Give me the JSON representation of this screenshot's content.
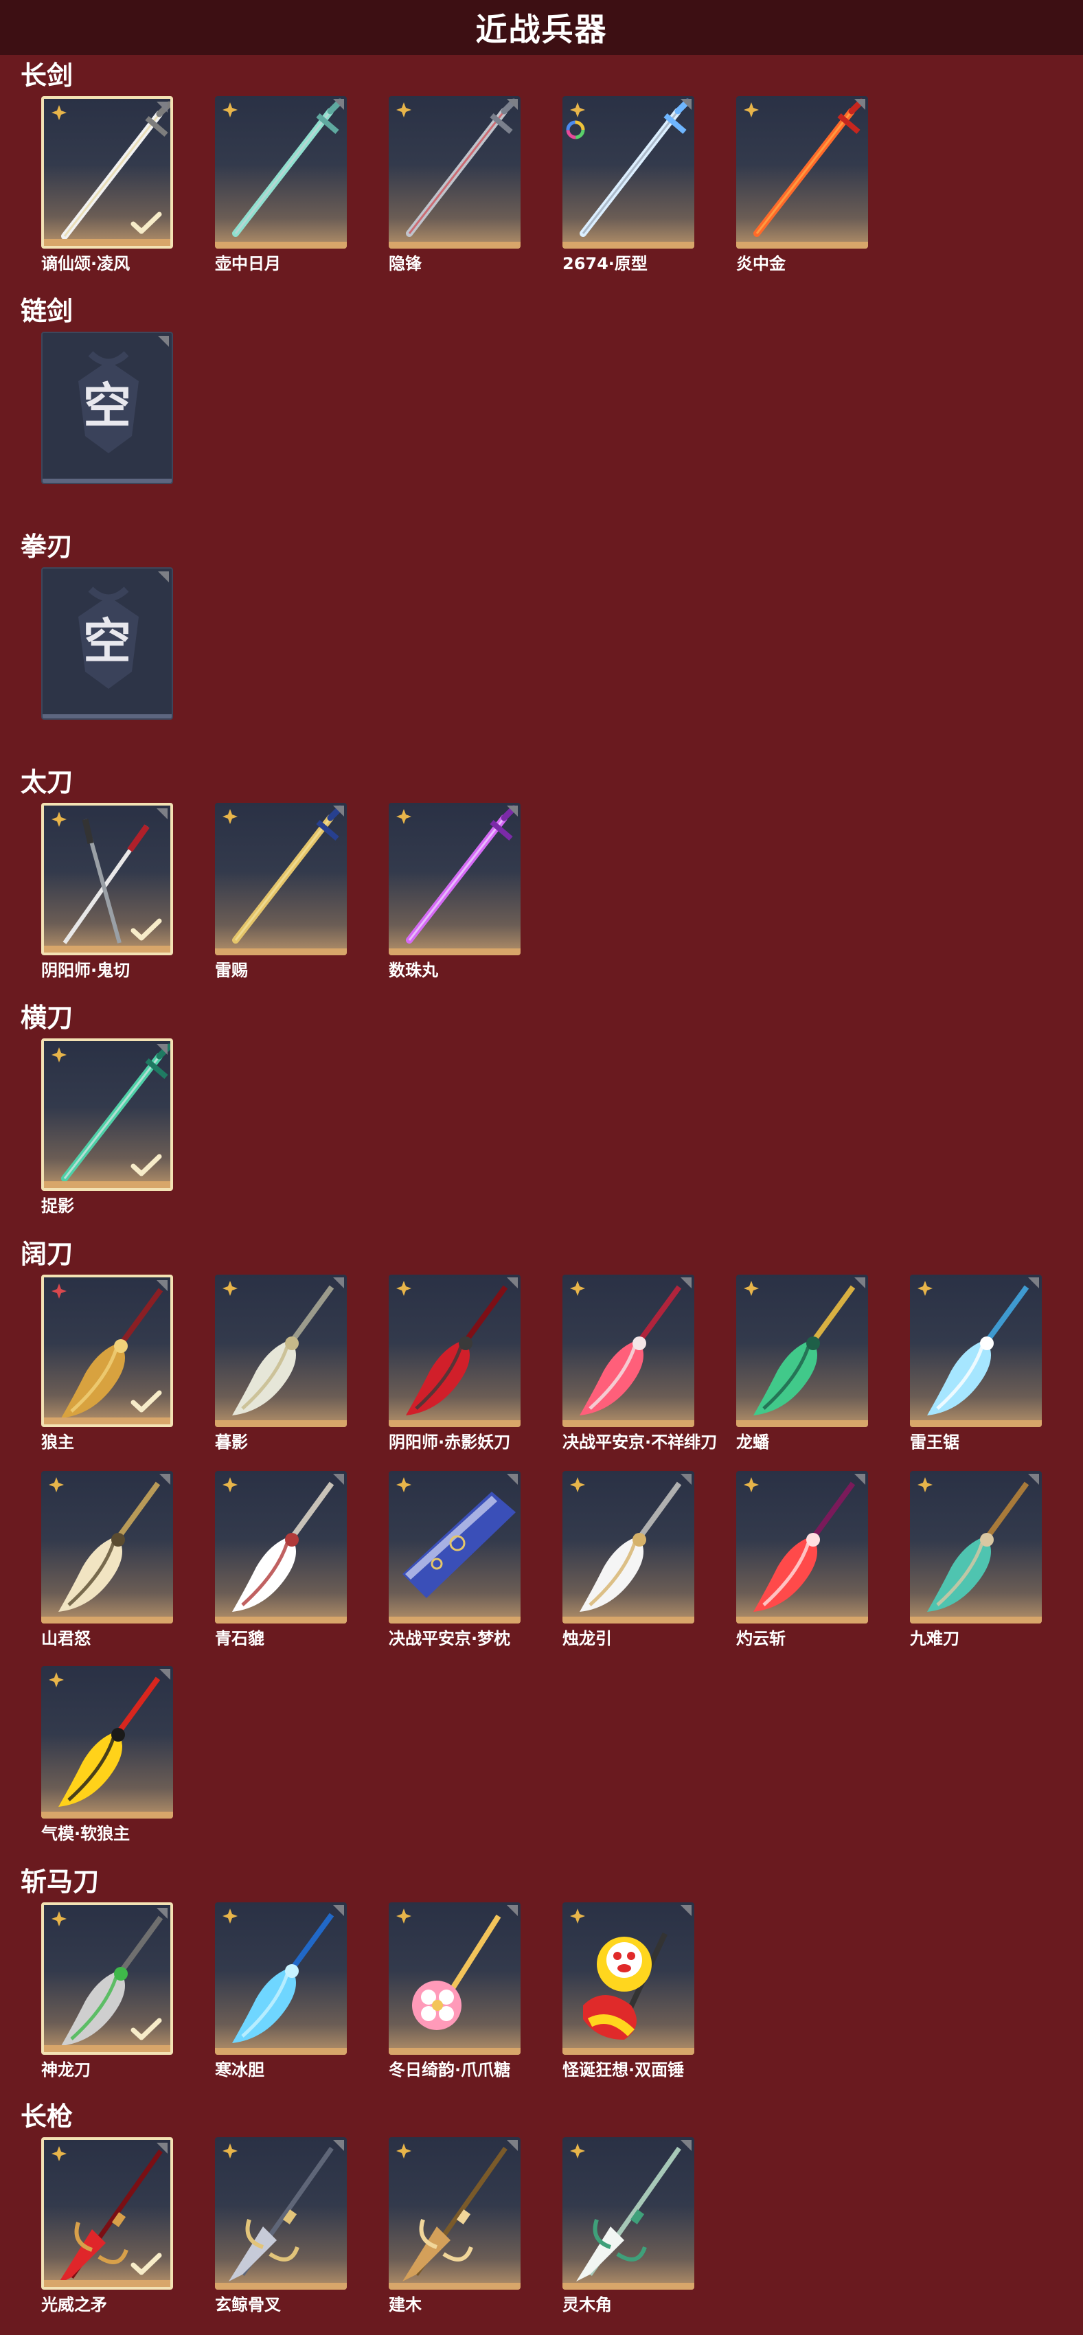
{
  "page_title": "近战兵器",
  "empty_glyph": "空",
  "colors": {
    "background": "#6a1a1f",
    "header": "#3d0f13",
    "frame": "#f3e2b4",
    "accent": "#d8a66a"
  },
  "sections": [
    {
      "title": "长剑",
      "items": [
        {
          "name": "谪仙颂·凌风",
          "selected": true,
          "badge": "gold-star",
          "icon": "longsword-silver"
        },
        {
          "name": "壶中日月",
          "selected": false,
          "badge": "gold-star",
          "icon": "longsword-teal"
        },
        {
          "name": "隐锋",
          "selected": false,
          "badge": "gold-star",
          "icon": "longsword-red-hilt"
        },
        {
          "name": "2674·原型",
          "selected": false,
          "badge": "gold-star",
          "icon": "longsword-blue-glow"
        },
        {
          "name": "炎中金",
          "selected": false,
          "badge": "gold-star",
          "icon": "longsword-flame"
        }
      ]
    },
    {
      "title": "链剑",
      "items": [
        {
          "name": "",
          "empty": true
        }
      ]
    },
    {
      "title": "拳刃",
      "items": [
        {
          "name": "",
          "empty": true
        }
      ]
    },
    {
      "title": "太刀",
      "items": [
        {
          "name": "阴阳师·鬼切",
          "selected": true,
          "badge": "gold-star",
          "icon": "katana-twin"
        },
        {
          "name": "雷赐",
          "selected": false,
          "badge": "gold-star",
          "icon": "katana-blue-gold"
        },
        {
          "name": "数珠丸",
          "selected": false,
          "badge": "gold-star",
          "icon": "katana-purple"
        }
      ]
    },
    {
      "title": "横刀",
      "items": [
        {
          "name": "捉影",
          "selected": true,
          "badge": "gold-star",
          "icon": "hengdao-jade"
        }
      ]
    },
    {
      "title": "阔刀",
      "items": [
        {
          "name": "狼主",
          "selected": true,
          "badge": "red-star",
          "icon": "broadblade-gold-red"
        },
        {
          "name": "暮影",
          "selected": false,
          "badge": "gold-star",
          "icon": "broadblade-silver"
        },
        {
          "name": "阴阳师·赤影妖刀",
          "selected": false,
          "badge": "gold-star",
          "icon": "broadblade-crimson"
        },
        {
          "name": "决战平安京·不祥绯刀",
          "selected": false,
          "badge": "gold-star",
          "icon": "broadblade-pink"
        },
        {
          "name": "龙蟠",
          "selected": false,
          "badge": "gold-star",
          "icon": "broadblade-jade-gold"
        },
        {
          "name": "雷王锯",
          "selected": false,
          "badge": "gold-star",
          "icon": "broadblade-ice"
        },
        {
          "name": "山君怒",
          "selected": false,
          "badge": "gold-star",
          "icon": "broadblade-tiger"
        },
        {
          "name": "青石貔",
          "selected": false,
          "badge": "gold-star",
          "icon": "broadblade-white"
        },
        {
          "name": "决战平安京·梦枕",
          "selected": false,
          "badge": "gold-star",
          "icon": "broadblade-scroll"
        },
        {
          "name": "烛龙引",
          "selected": false,
          "badge": "gold-star",
          "icon": "broadblade-silver-dragon"
        },
        {
          "name": "灼云斩",
          "selected": false,
          "badge": "gold-star",
          "icon": "broadblade-red-cloud"
        },
        {
          "name": "九难刀",
          "selected": false,
          "badge": "gold-star",
          "icon": "broadblade-bronze"
        },
        {
          "name": "气模·软狼主",
          "selected": false,
          "badge": "gold-star",
          "icon": "broadblade-inflatable"
        }
      ]
    },
    {
      "title": "斩马刀",
      "items": [
        {
          "name": "神龙刀",
          "selected": true,
          "badge": "gold-star",
          "icon": "zhanmadao-dragon"
        },
        {
          "name": "寒冰胆",
          "selected": false,
          "badge": "gold-star",
          "icon": "zhanmadao-ice"
        },
        {
          "name": "冬日绮韵·爪爪糖",
          "selected": false,
          "badge": "gold-star",
          "icon": "zhanmadao-candy"
        },
        {
          "name": "怪诞狂想·双面锤",
          "selected": false,
          "badge": "gold-star",
          "icon": "hammer-clown"
        }
      ]
    },
    {
      "title": "长枪",
      "items": [
        {
          "name": "光威之矛",
          "selected": true,
          "badge": "gold-star",
          "icon": "spear-red"
        },
        {
          "name": "玄鲸骨叉",
          "selected": false,
          "badge": "gold-star",
          "icon": "spear-trident"
        },
        {
          "name": "建木",
          "selected": false,
          "badge": "gold-star",
          "icon": "spear-wood"
        },
        {
          "name": "灵木角",
          "selected": false,
          "badge": "gold-star",
          "icon": "spear-antler"
        }
      ]
    }
  ]
}
